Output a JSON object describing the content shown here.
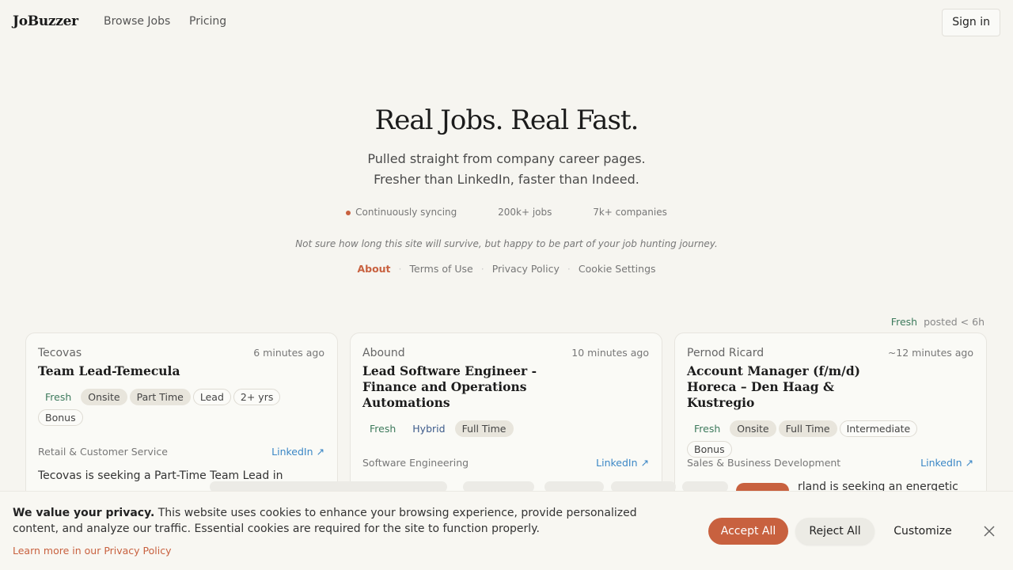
{
  "header": {
    "logo": "JoBuzzer",
    "nav": [
      "Browse Jobs",
      "Pricing"
    ],
    "signin": "Sign in"
  },
  "hero": {
    "title": "Real Jobs. Real Fast.",
    "sub1": "Pulled straight from company career pages.",
    "sub2": "Fresher than LinkedIn, faster than Indeed.",
    "stats": [
      "Continuously syncing",
      "200k+ jobs",
      "7k+ companies"
    ],
    "tagline": "Not sure how long this site will survive, but happy to be part of your job hunting journey.",
    "links": [
      "About",
      "Terms of Use",
      "Privacy Policy",
      "Cookie Settings"
    ]
  },
  "legend": {
    "fresh": "Fresh",
    "text": "posted < 6h"
  },
  "jobs": [
    {
      "company": "Tecovas",
      "time": "6 minutes ago",
      "title": "Team Lead-Temecula",
      "tags": [
        "Fresh",
        "Onsite",
        "Part Time",
        "Lead",
        "2+ yrs",
        "Bonus"
      ],
      "category": "Retail & Customer Service",
      "source": "LinkedIn ↗",
      "desc": "Tecovas is seeking a Part-Time Team Lead in"
    },
    {
      "company": "Abound",
      "time": "10 minutes ago",
      "title": "Lead Software Engineer - Finance and Operations Automations",
      "tags": [
        "Fresh",
        "Hybrid",
        "Full Time"
      ],
      "category": "Software Engineering",
      "source": "LinkedIn ↗",
      "desc": ""
    },
    {
      "company": "Pernod Ricard",
      "time": "~12 minutes ago",
      "title": "Account Manager (f/m/d) Horeca – Den Haag & Kustregio",
      "tags": [
        "Fresh",
        "Onsite",
        "Full Time",
        "Intermediate",
        "Bonus"
      ],
      "category": "Sales & Business Development",
      "source": "LinkedIn ↗",
      "desc": "rland is seeking an energetic"
    }
  ],
  "cookie": {
    "bold": "We value your privacy.",
    "text": " This website uses cookies to enhance your browsing experience, provide personalized content, and analyze our traffic. Essential cookies are required for the site to function properly.",
    "link": "Learn more in our Privacy Policy",
    "accept": "Accept All",
    "reject": "Reject All",
    "customize": "Customize"
  },
  "colors": {
    "accent": "#c8613f",
    "fresh": "#3d7a5c",
    "link": "#3b87c6"
  }
}
